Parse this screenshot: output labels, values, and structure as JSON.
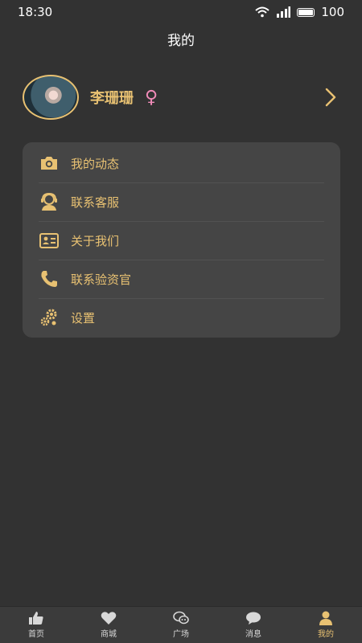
{
  "status_bar": {
    "time": "18:30",
    "battery": "100"
  },
  "header": {
    "title": "我的"
  },
  "profile": {
    "name": "李珊珊",
    "gender_symbol": "♀"
  },
  "menu": {
    "items": [
      {
        "label": "我的动态",
        "icon": "camera-icon"
      },
      {
        "label": "联系客服",
        "icon": "customer-service-icon"
      },
      {
        "label": "关于我们",
        "icon": "id-card-icon"
      },
      {
        "label": "联系验资官",
        "icon": "phone-icon"
      },
      {
        "label": "设置",
        "icon": "gear-icon"
      }
    ]
  },
  "tab_bar": {
    "tabs": [
      {
        "label": "首页",
        "icon": "thumbs-up-icon"
      },
      {
        "label": "商城",
        "icon": "heart-icon"
      },
      {
        "label": "广场",
        "icon": "chat-bubbles-icon"
      },
      {
        "label": "消息",
        "icon": "message-icon"
      },
      {
        "label": "我的",
        "icon": "user-icon",
        "active": true
      }
    ]
  },
  "colors": {
    "accent": "#e8c172",
    "background": "#323232",
    "card": "#454545",
    "gender": "#f08bb8"
  }
}
